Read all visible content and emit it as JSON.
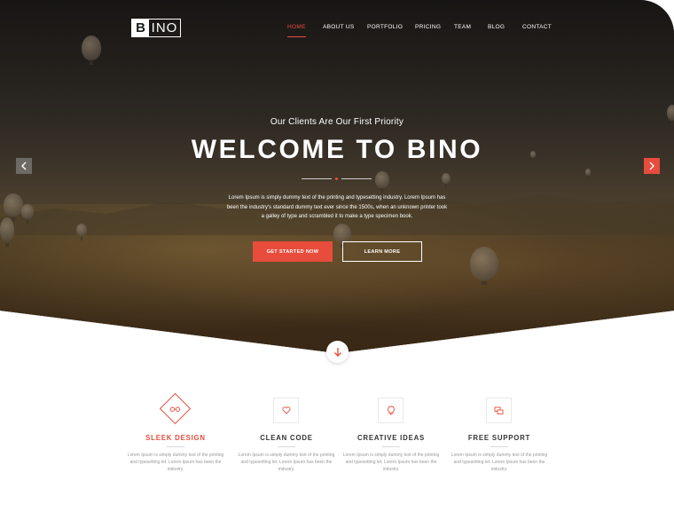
{
  "brand": {
    "logo_letter": "B",
    "logo_rest": "INO",
    "accent": "#e74c3c"
  },
  "nav": {
    "items": [
      {
        "label": "HOME",
        "active": true
      },
      {
        "label": "ABOUT US"
      },
      {
        "label": "PORTFOLIO"
      },
      {
        "label": "PRICING"
      },
      {
        "label": "TEAM"
      },
      {
        "label": "BLOG"
      },
      {
        "label": "CONTACT"
      }
    ]
  },
  "hero": {
    "subtitle": "Our Clients Are Our First Priority",
    "title": "WELCOME TO BINO",
    "description": "Lorem Ipsum is simply dummy text of the printing and typesetting industry. Lorem Ipsum has been the industry's standard dummy text ever since the 1500s, when an unknown printer took a galley of type and scrambled it to make a type specimen book.",
    "primary_button": "GET STARTED NOW",
    "secondary_button": "LEARN MORE",
    "prev_icon": "chevron-left-icon",
    "next_icon": "chevron-right-icon",
    "scroll_icon": "arrow-down-icon"
  },
  "features": [
    {
      "title": "SLEEK DESIGN",
      "icon": "glasses-icon",
      "highlight": true,
      "desc": "Lorem Ipsum is simply dummy text of the printing and typesetting let. Lorem Ipsum has been the industry."
    },
    {
      "title": "CLEAN CODE",
      "icon": "heart-icon",
      "highlight": false,
      "desc": "Lorem Ipsum is simply dummy text of the printing and typesetting let. Lorem Ipsum has been the industry."
    },
    {
      "title": "CREATIVE IDEAS",
      "icon": "lightbulb-icon",
      "highlight": false,
      "desc": "Lorem Ipsum is simply dummy text of the printing and typesetting let. Lorem Ipsum has been the industry."
    },
    {
      "title": "FREE SUPPORT",
      "icon": "chat-icon",
      "highlight": false,
      "desc": "Lorem Ipsum is simply dummy text of the printing and typesetting let. Lorem Ipsum has been the industry."
    }
  ]
}
